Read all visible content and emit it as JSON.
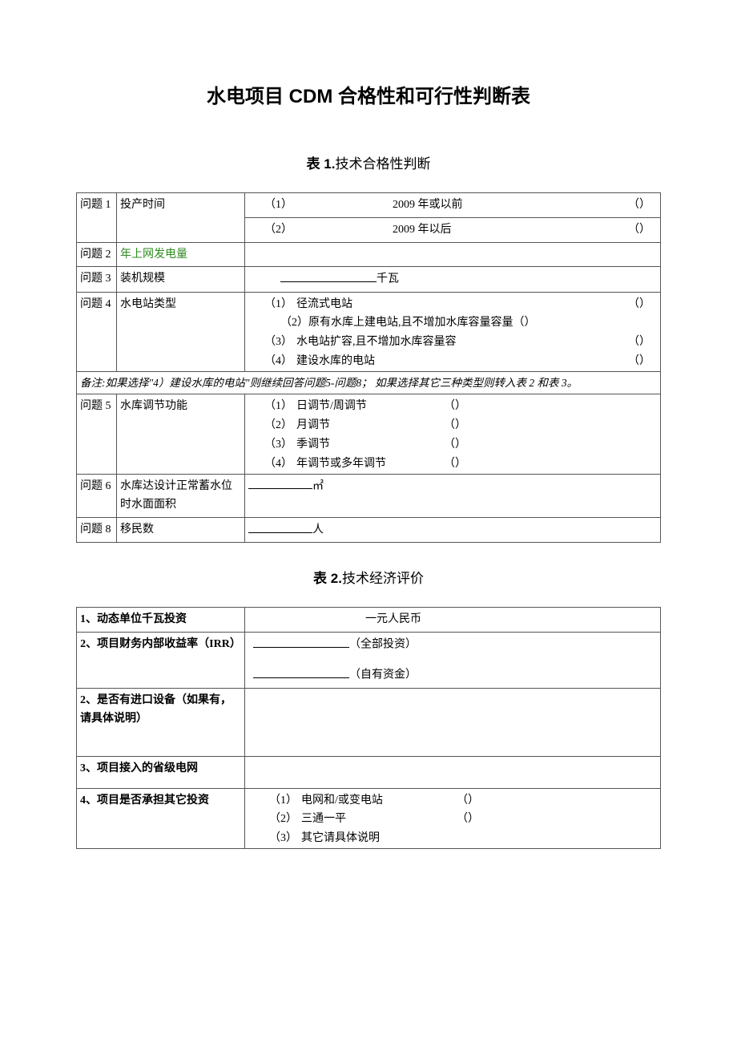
{
  "doc_title": "水电项目 CDM 合格性和可行性判断表",
  "table1": {
    "caption_prefix": "表 1.",
    "caption_text": "技术合格性判断",
    "rows": {
      "q1": {
        "id": "问题 1",
        "label": "投产时间",
        "opt1_n": "（1）",
        "opt1_t": "2009 年或以前",
        "opt2_n": "（2）",
        "opt2_t": "2009 年以后",
        "paren": "（）"
      },
      "q2": {
        "id": "问题 2",
        "label": "年上网发电量"
      },
      "q3": {
        "id": "问题 3",
        "label": "装机规模",
        "unit": "千瓦"
      },
      "q4": {
        "id": "问题 4",
        "label": "水电站类型",
        "o1_n": "（1）",
        "o1_t": "径流式电站",
        "o2_n": "（2）",
        "o2_t": "原有水库上建电站,且不增加水库容量容量",
        "o3_n": "（3）",
        "o3_t": "水电站扩容,且不增加水库容量容",
        "o4_n": "（4）",
        "o4_t": "建设水库的电站",
        "paren": "（）"
      },
      "note": "备注:如果选择\"4）建设水库的电站\"则继续回答问题5-问题8； 如果选择其它三种类型则转入表 2 和表 3。",
      "q5": {
        "id": "问题 5",
        "label": "水库调节功能",
        "o1_n": "（1）",
        "o1_t": "日调节/周调节",
        "o2_n": "（2）",
        "o2_t": "月调节",
        "o3_n": "（3）",
        "o3_t": "季调节",
        "o4_n": "（4）",
        "o4_t": "年调节或多年调节",
        "paren": "（）"
      },
      "q6": {
        "id": "问题 6",
        "label": "水库达设计正常蓄水位时水面面积",
        "unit": "㎡"
      },
      "q8": {
        "id": "问题 8",
        "label": "移民数",
        "unit": "人"
      }
    }
  },
  "table2": {
    "caption_prefix": "表 2.",
    "caption_text": "技术经济评价",
    "r1": {
      "label": "1、动态单位千瓦投资",
      "unit": "一元人民币"
    },
    "r2": {
      "label": "2、项目财务内部收益率（IRR）",
      "v1": "（全部投资）",
      "v2": "（自有资金）"
    },
    "r3": {
      "label": "2、是否有进口设备（如果有，请具体说明）"
    },
    "r4": {
      "label": "3、项目接入的省级电网"
    },
    "r5": {
      "label": "4、项目是否承担其它投资",
      "o1_n": "（1）",
      "o1_t": "电网和/或变电站",
      "o2_n": "（2）",
      "o2_t": "三通一平",
      "o3_n": "（3）",
      "o3_t": "其它请具体说明",
      "paren": "（）"
    }
  }
}
